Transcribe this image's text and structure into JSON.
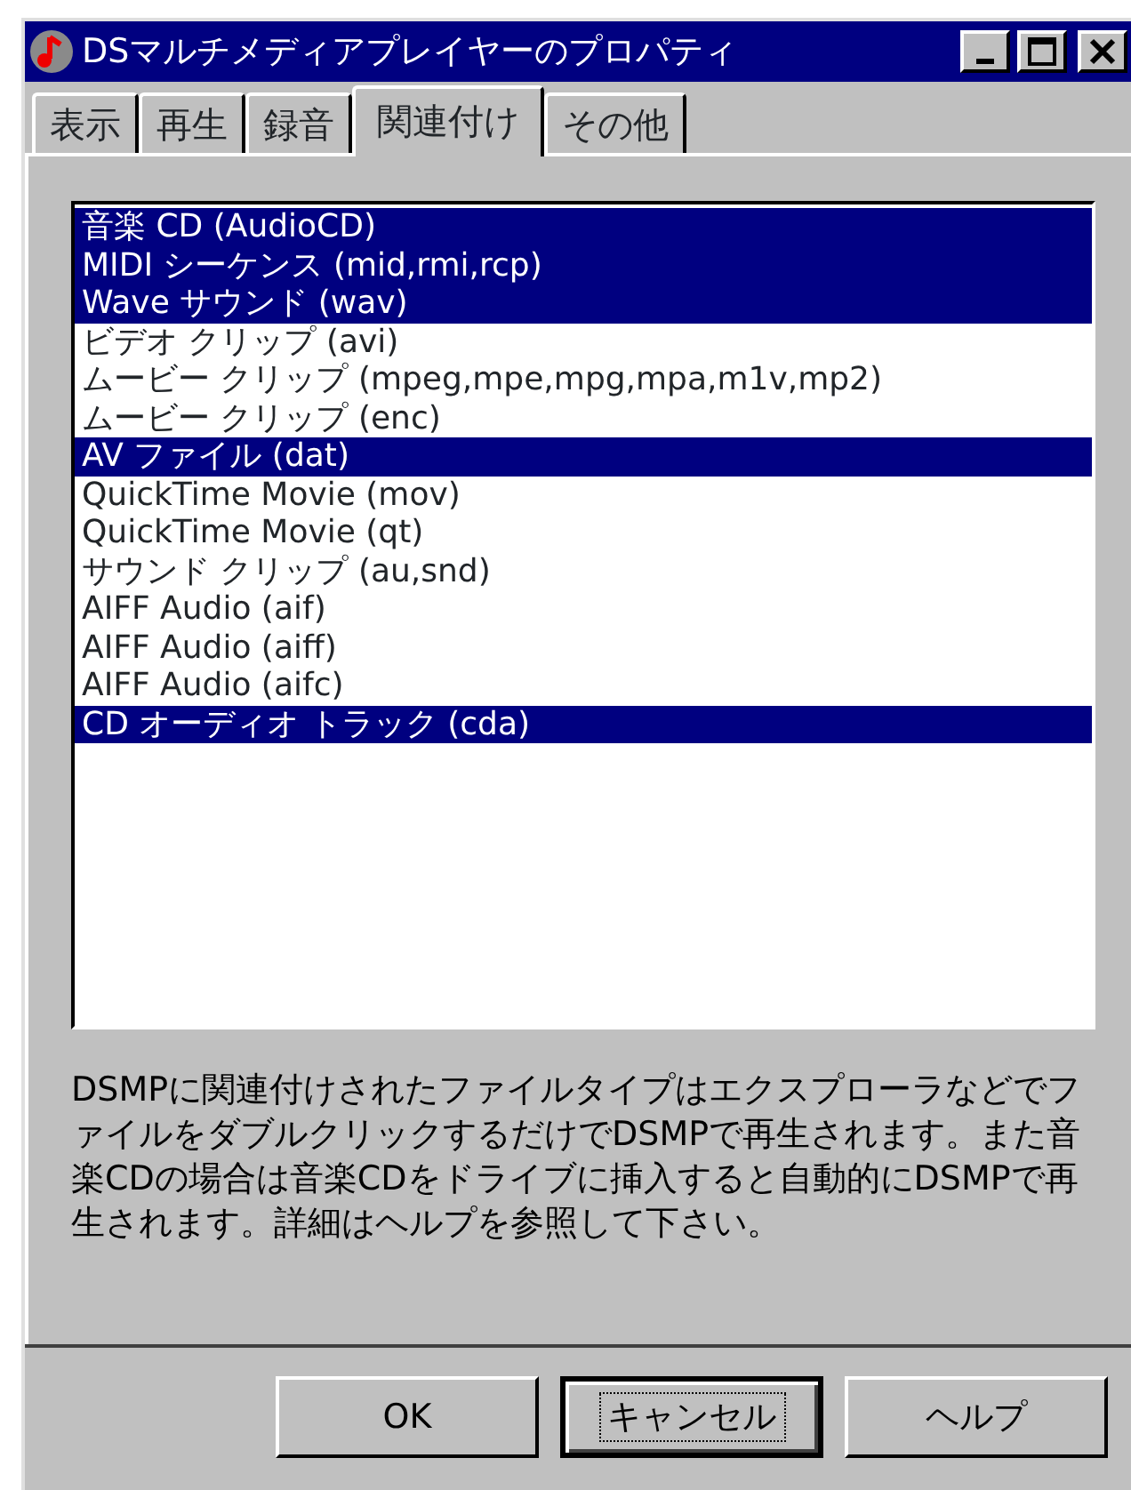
{
  "window": {
    "title": "DSマルチメディアプレイヤーのプロパティ"
  },
  "tabs": [
    {
      "label": "表示",
      "selected": false
    },
    {
      "label": "再生",
      "selected": false
    },
    {
      "label": "録音",
      "selected": false
    },
    {
      "label": "関連付け",
      "selected": true
    },
    {
      "label": "その他",
      "selected": false
    }
  ],
  "file_types": [
    {
      "label": "音楽 CD (AudioCD)",
      "selected": true
    },
    {
      "label": "MIDI シーケンス (mid,rmi,rcp)",
      "selected": true
    },
    {
      "label": "Wave サウンド (wav)",
      "selected": true
    },
    {
      "label": "ビデオ クリップ (avi)",
      "selected": false
    },
    {
      "label": "ムービー クリップ (mpeg,mpe,mpg,mpa,m1v,mp2)",
      "selected": false
    },
    {
      "label": "ムービー クリップ (enc)",
      "selected": false
    },
    {
      "label": "AV ファイル (dat)",
      "selected": true
    },
    {
      "label": "QuickTime Movie (mov)",
      "selected": false
    },
    {
      "label": "QuickTime Movie (qt)",
      "selected": false
    },
    {
      "label": "サウンド クリップ (au,snd)",
      "selected": false
    },
    {
      "label": "AIFF Audio (aif)",
      "selected": false
    },
    {
      "label": "AIFF Audio (aiff)",
      "selected": false
    },
    {
      "label": "AIFF Audio (aifc)",
      "selected": false
    },
    {
      "label": "CD オーディオ トラック (cda)",
      "selected": true
    }
  ],
  "description": "DSMPに関連付けされたファイルタイプはエクスプローラなどでファイルをダブルクリックするだけでDSMPで再生されます。また音楽CDの場合は音楽CDをドライブに挿入すると自動的にDSMPで再生されます。詳細はヘルプを参照して下さい。",
  "buttons": [
    {
      "label": "OK",
      "focused": false
    },
    {
      "label": "キャンセル",
      "focused": true
    },
    {
      "label": "ヘルプ",
      "focused": false
    }
  ]
}
